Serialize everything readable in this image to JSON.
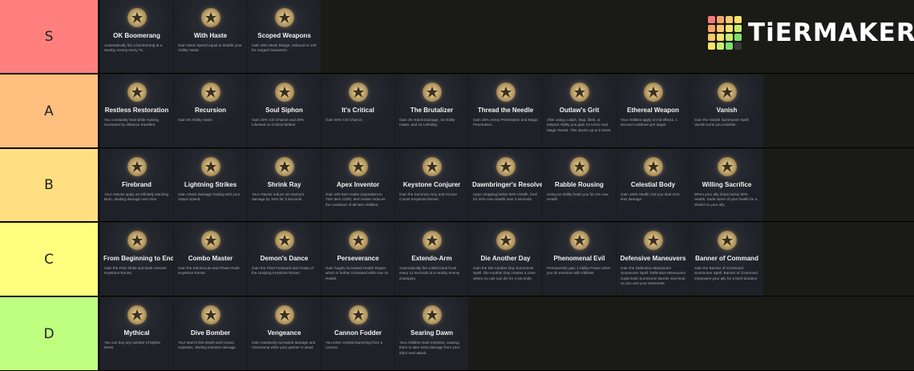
{
  "app": {
    "brand": "TiERMAKER",
    "brand_grid_colors": [
      "#f47c7c",
      "#f7a46b",
      "#f9c76b",
      "#f9e36b",
      "#f7a46b",
      "#f9c76b",
      "#f9e36b",
      "#c8ee6c",
      "#f9c76b",
      "#f9e36b",
      "#c8ee6c",
      "#7ee06c",
      "#f9e36b",
      "#c8ee6c",
      "#7ee06c",
      "#3a3a3a"
    ]
  },
  "tiers": [
    {
      "label": "S",
      "color": "#ff7f7f",
      "cards": [
        {
          "name": "OK Boomerang",
          "icon": "boomerang-icon",
          "desc": "Automatically fire a boomerang at a nearby enemy every 7s."
        },
        {
          "name": "With Haste",
          "icon": "wing-boot-icon",
          "desc": "Gain Move Speed equal to double your Ability Haste."
        },
        {
          "name": "Scoped Weapons",
          "icon": "crosshair-icon",
          "desc": "Gain 300 Attack Range, reduced to 100 for ranged characters."
        }
      ]
    },
    {
      "label": "A",
      "color": "#ffbf7f",
      "cards": [
        {
          "name": "Restless Restoration",
          "icon": "running-figure-icon",
          "desc": "You constantly heal while moving, increased by distance travelled."
        },
        {
          "name": "Recursion",
          "icon": "hourglass-icon",
          "desc": "Gain 60 Ability Haste."
        },
        {
          "name": "Soul Siphon",
          "icon": "soul-swirl-icon",
          "desc": "Gain 20% Crit Chance and 30% Lifesteal on Critical Strikes."
        },
        {
          "name": "It's Critical",
          "icon": "critical-arrow-icon",
          "desc": "Gain 60% Crit Chance."
        },
        {
          "name": "The Brutalizer",
          "icon": "axe-icon",
          "desc": "Gain 25 Attack Damage, 10 Ability Haste, and 15 Lethality."
        },
        {
          "name": "Thread the Needle",
          "icon": "needle-icon",
          "desc": "Gain 25% Armor Penetration and Magic Penetration."
        },
        {
          "name": "Outlaw's Grit",
          "icon": "shield-badge-icon",
          "desc": "After using a dash, leap, blink, or teleport Ability you gain 15 Armor and Magic Resist. This stacks up to 5 times."
        },
        {
          "name": "Ethereal Weapon",
          "icon": "ethereal-blade-icon",
          "desc": "Your Abilities apply on-hit effects. 1 second cooldown per target."
        },
        {
          "name": "Vanish",
          "icon": "vanish-mask-icon",
          "desc": "Gain the Vanish Summoner Spell. Vanish turns you invisible."
        }
      ]
    },
    {
      "label": "B",
      "color": "#ffdf7f",
      "cards": [
        {
          "name": "Firebrand",
          "icon": "flame-arc-icon",
          "desc": "Your Attacks apply an infinitely stacking Burn, dealing damage over time."
        },
        {
          "name": "Lightning Strikes",
          "icon": "lightning-icon",
          "desc": "Gain Attack Damage scaling with your Attack Speed."
        },
        {
          "name": "Shrink Ray",
          "icon": "shrink-burst-icon",
          "desc": "Your Attacks reduce an enemy's damage by 15% for 3 seconds."
        },
        {
          "name": "Apex Inventor",
          "icon": "inventor-gear-icon",
          "desc": "Gain 300 Item Haste (equivalent to 75% Item CDR). Item Haste reduces the cooldown of all Item Abilities."
        },
        {
          "name": "Keystone Conjurer",
          "icon": "keystone-icon",
          "desc": "Gain the Summon Aery and Arcane Comet Keystone Runes."
        },
        {
          "name": "Dawnbringer's Resolve",
          "icon": "dawn-wings-icon",
          "desc": "Upon dropping below 50% Health, heal for 30% max Health over 3 seconds."
        },
        {
          "name": "Rabble Rousing",
          "icon": "rabble-cross-icon",
          "desc": "Using an Ability heals you for 2% max Health."
        },
        {
          "name": "Celestial Body",
          "icon": "celestial-orb-icon",
          "desc": "Gain 1000 Health, but you deal 10% less damage."
        },
        {
          "name": "Willing Sacrifice",
          "icon": "heart-sacrifice-icon",
          "desc": "When your ally drops below 30% Health, trade some of your health for a Shield on your ally."
        }
      ]
    },
    {
      "label": "C",
      "color": "#ffff7f",
      "cards": [
        {
          "name": "From Beginning to End",
          "icon": "start-end-icon",
          "desc": "Gain the First Strike and Dark Harvest Keystone Runes."
        },
        {
          "name": "Combo Master",
          "icon": "combo-claw-icon",
          "desc": "Gain the Electrocute and Phase Rush Keystone Runes."
        },
        {
          "name": "Demon's Dance",
          "icon": "demon-icon",
          "desc": "Gain the Fleet Footwork and Grasp of the Undying Keystone Runes."
        },
        {
          "name": "Perseverance",
          "icon": "perseverance-icon",
          "desc": "Gain hugely increased Health Regen, which is further increased while low on Health."
        },
        {
          "name": "Extendo-Arm",
          "icon": "extendo-arm-icon",
          "desc": "Automatically fire a Blitzcrank hook every 12 seconds at a nearby enemy champion."
        },
        {
          "name": "Die Another Day",
          "icon": "skull-crown-icon",
          "desc": "Gain the Die Another Day Summoner Spell. Die Another Day creates a zone where no unit can die for 4 seconds."
        },
        {
          "name": "Phenomenal Evil",
          "icon": "evil-hat-icon",
          "desc": "Permanently gain 1 Ability Power when you hit enemies with Abilities."
        },
        {
          "name": "Defensive Maneuvers",
          "icon": "defensive-orb-icon",
          "desc": "Gain the Defensive Maneuvers Summoner Spell. Defensive Maneuvers Casts both Summoner Barrier and Heal on you and your teammate."
        },
        {
          "name": "Banner of Command",
          "icon": "banner-icon",
          "desc": "Gain the Banner of Command Summoner Spell. Banner of Command empowers your ally for a brief duration."
        }
      ]
    },
    {
      "label": "D",
      "color": "#bfff7f",
      "cards": [
        {
          "name": "Mythical",
          "icon": "mythic-chest-icon",
          "desc": "You can buy any number of Mythic Items."
        },
        {
          "name": "Dive Bomber",
          "icon": "dive-bomber-icon",
          "desc": "Your team's first death each round explodes, dealing massive damage."
        },
        {
          "name": "Vengeance",
          "icon": "crossed-swords-icon",
          "desc": "Gain massively increased damage and Omnivamp while your partner is dead."
        },
        {
          "name": "Cannon Fodder",
          "icon": "cannon-icon",
          "desc": "You enter combat launching from a cannon."
        },
        {
          "name": "Searing Dawn",
          "icon": "searing-star-icon",
          "desc": "Your Abilities mark enemies, causing them to take extra damage from your ally's next attack."
        }
      ]
    }
  ]
}
